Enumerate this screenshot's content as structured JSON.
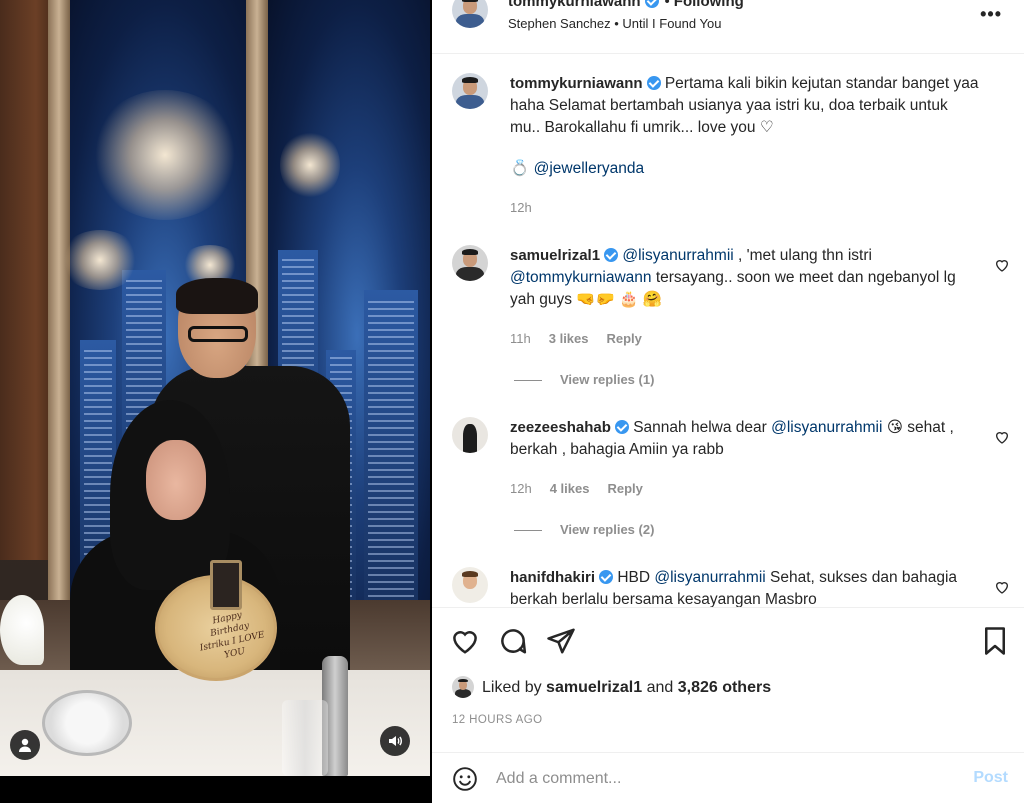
{
  "header": {
    "username": "tommykurniawann",
    "dot": "•",
    "follow_status": "Following",
    "music": "Stephen Sanchez • Until I Found You",
    "more_label": "•••"
  },
  "photo": {
    "plate_text": "Happy Birthday Istriku I LOVE YOU"
  },
  "caption": {
    "username": "tommykurniawann",
    "text": "Pertama kali bikin kejutan standar banget yaa haha Selamat bertambah usianya yaa istri ku, doa terbaik untuk mu.. Barokallahu fi umrik... love you ♡",
    "tag_icon": "💍",
    "tag": "@jewelleryanda",
    "time": "12h"
  },
  "comments": [
    {
      "username": "samuelrizal1",
      "mention1": "@lisyanurrahmii",
      "text1": " , 'met ulang thn istri ",
      "mention2": "@tommykurniawann",
      "text2": " tersayang.. soon we meet dan ngebanyol lg yah guys 🤜🤛 🎂 🤗",
      "time": "11h",
      "likes": "3 likes",
      "reply": "Reply",
      "view_replies": "View replies (1)"
    },
    {
      "username": "zeezeeshahab",
      "text1": "Sannah helwa dear ",
      "mention1": "@lisyanurrahmii",
      "text2": " 😘 sehat , berkah , bahagia Amiin ya rabb",
      "time": "12h",
      "likes": "4 likes",
      "reply": "Reply",
      "view_replies": "View replies (2)"
    },
    {
      "username": "hanifdhakiri",
      "text1": "HBD ",
      "mention1": "@lisyanurrahmii",
      "text2": " Sehat, sukses dan bahagia berkah berlalu bersama kesayangan Masbro"
    }
  ],
  "likes": {
    "prefix": "Liked by",
    "user": "samuelrizal1",
    "and": "and",
    "others": "3,826 others"
  },
  "timestamp": "12 HOURS AGO",
  "add_comment": {
    "placeholder": "Add a comment...",
    "post": "Post"
  },
  "colors": {
    "verified": "#3897f0",
    "mention": "#00376b",
    "muted": "#8e8e8e",
    "post_disabled": "#b3dbff"
  },
  "icons": [
    "heart-icon",
    "comment-icon",
    "share-icon",
    "bookmark-icon",
    "emoji-icon",
    "user-tag-icon",
    "sound-icon",
    "verified-icon",
    "more-icon"
  ]
}
